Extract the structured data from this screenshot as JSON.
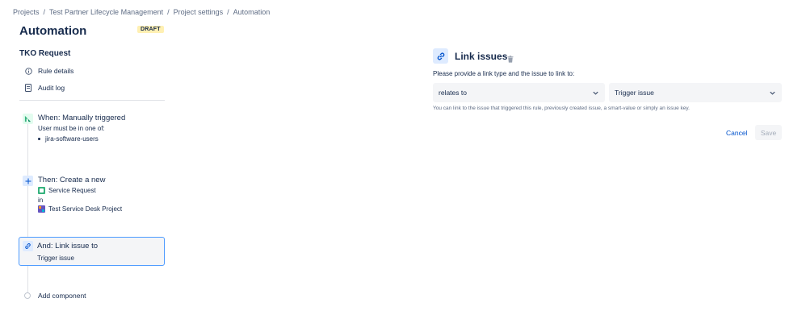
{
  "breadcrumb": {
    "items": [
      "Projects",
      "Test Partner Lifecycle Management",
      "Project settings",
      "Automation"
    ],
    "separator": "/"
  },
  "page": {
    "title": "Automation",
    "badge": "DRAFT"
  },
  "rule": {
    "name": "TKO Request",
    "links": [
      {
        "label": "Rule details",
        "icon": "info-icon"
      },
      {
        "label": "Audit log",
        "icon": "document-icon"
      }
    ]
  },
  "components": {
    "trigger": {
      "title": "When: Manually triggered",
      "line1": "User must be in one of:",
      "group": "jira-software-users",
      "icon": "trigger-icon",
      "color": "#36b37e"
    },
    "action": {
      "title": "Then: Create a new",
      "issue_type": "Service Request",
      "in_label": "in",
      "project": "Test Service Desk Project",
      "icon": "plus-icon"
    },
    "link": {
      "title": "And: Link issue to",
      "target": "Trigger issue",
      "icon": "link-icon"
    },
    "add_label": "Add component"
  },
  "panel": {
    "title": "Link issues",
    "description": "Please provide a link type and the issue to link to:",
    "link_type": "relates to",
    "issue_target": "Trigger issue",
    "helper": "You can link to the issue that triggered this rule, previously created issue, a smart-value or simply an issue key.",
    "cancel_label": "Cancel",
    "save_label": "Save"
  },
  "colors": {
    "accent": "#0052cc",
    "selected_border": "#4c9aff",
    "draft_bg": "#fff0b3"
  }
}
